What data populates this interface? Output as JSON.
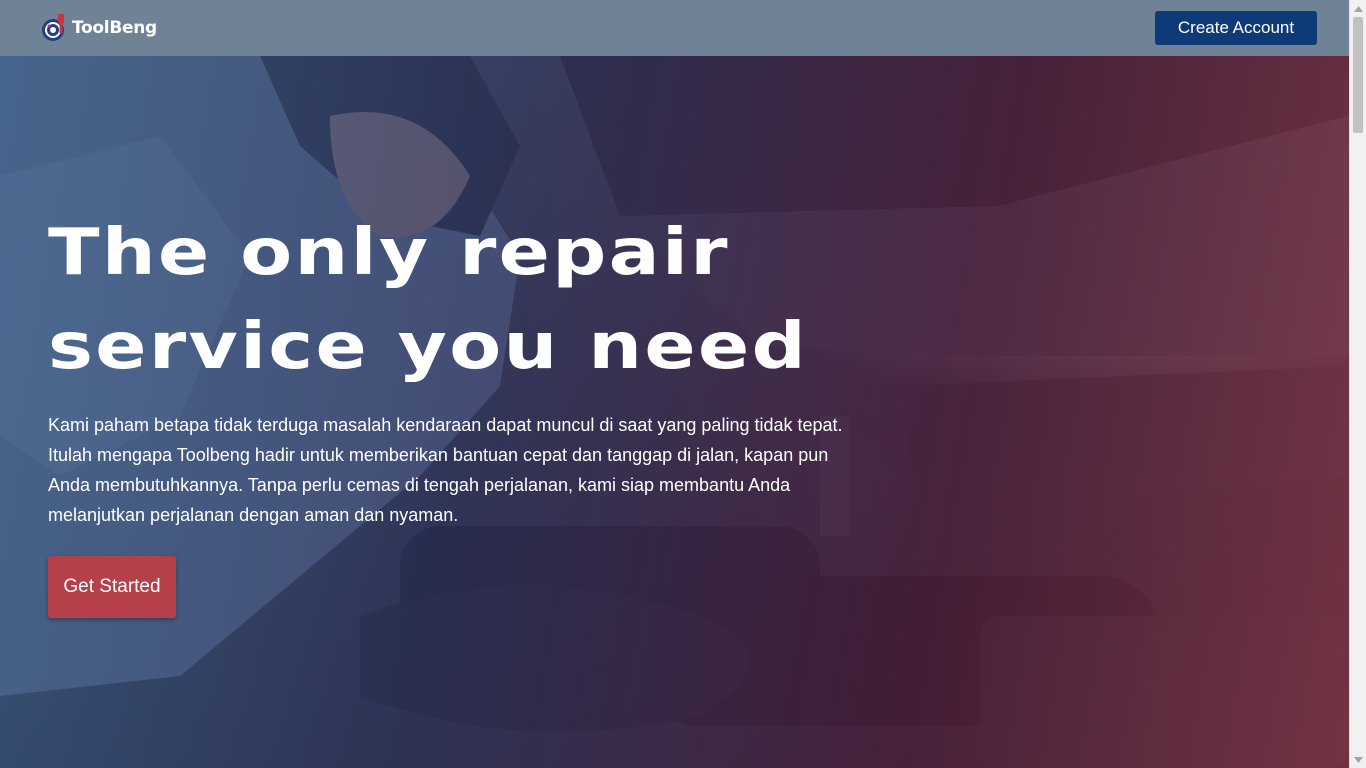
{
  "header": {
    "brand_name": "ToolBeng",
    "logo_icon": "wrench-gear-icon",
    "create_account_label": "Create Account"
  },
  "hero": {
    "title": "The only repair service you need",
    "description": "Kami paham betapa tidak terduga masalah kendaraan dapat muncul di saat yang paling tidak tepat. Itulah mengapa Toolbeng hadir untuk memberikan bantuan cepat dan tanggap di jalan, kapan pun Anda membutuhkannya. Tanpa perlu cemas di tengah perjalanan, kami siap membantu Anda melanjutkan perjalanan dengan aman dan nyaman.",
    "cta_label": "Get Started",
    "background_image": "mechanic-repairing-car-engine-photo"
  },
  "colors": {
    "navbar": "#6f8296",
    "create_button": "#0f3a78",
    "cta_button": "#b5404a",
    "overlay_left": "#3a5c87",
    "overlay_right": "#963c50"
  },
  "scrollbar": {
    "up_icon": "scroll-up-arrow-icon",
    "down_icon": "scroll-down-arrow-icon"
  }
}
